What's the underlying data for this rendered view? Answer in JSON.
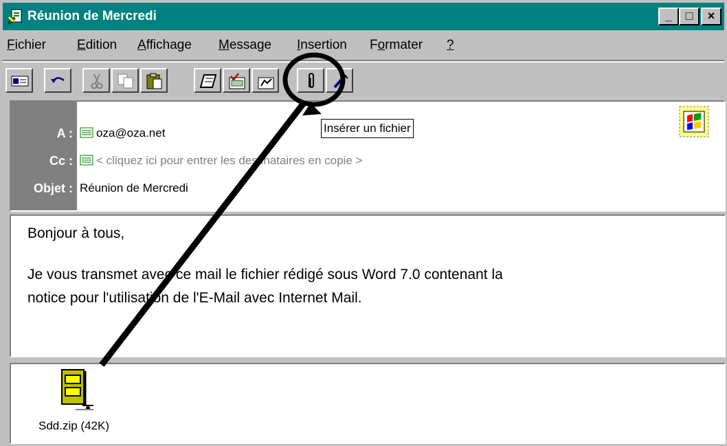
{
  "window": {
    "title": "Réunion de Mercredi",
    "controls": {
      "minimize": "_",
      "maximize": "□",
      "close": "×"
    }
  },
  "menu": {
    "items": [
      {
        "pre": "",
        "key": "F",
        "post": "ichier"
      },
      {
        "pre": "",
        "key": "E",
        "post": "dition"
      },
      {
        "pre": "",
        "key": "A",
        "post": "ffichage"
      },
      {
        "pre": "",
        "key": "M",
        "post": "essage"
      },
      {
        "pre": "",
        "key": "I",
        "post": "nsertion"
      },
      {
        "pre": "F",
        "key": "o",
        "post": "rmater"
      },
      {
        "pre": "",
        "key": "?",
        "post": ""
      }
    ]
  },
  "toolbar": {
    "buttons": [
      "send-icon",
      "undo-icon",
      "cut-icon",
      "copy-icon",
      "paste-icon",
      "address-book-icon",
      "check-names-icon",
      "select-recipients-icon",
      "paperclip-icon",
      "signature-icon"
    ]
  },
  "tooltip": {
    "text": "Insérer un fichier"
  },
  "header": {
    "to_label": "A :",
    "to_value": "oza@oza.net",
    "cc_label": "Cc :",
    "cc_value": "< cliquez ici pour entrer les destinataires en copie >",
    "subject_label": "Objet :",
    "subject_value": "Réunion de Mercredi"
  },
  "body": {
    "line1": "Bonjour à tous,",
    "line2": "Je vous transmet avec ce mail le fichier rédigé sous Word 7.0 contenant la",
    "line3": "notice pour l'utilisation de l'E-Mail avec Internet Mail."
  },
  "attachment": {
    "label": "Sdd.zip (42K)",
    "icon": "zip-archive-icon"
  },
  "colors": {
    "titlebar": "#008080",
    "face": "#c0c0c0",
    "shadow": "#808080"
  }
}
